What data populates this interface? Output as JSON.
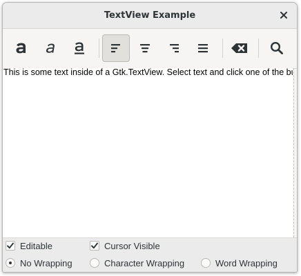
{
  "window": {
    "title": "TextView Example"
  },
  "toolbar": {
    "buttons": [
      {
        "name": "bold-button",
        "icon": "format-text-bold-icon"
      },
      {
        "name": "italic-button",
        "icon": "format-text-italic-icon"
      },
      {
        "name": "underline-button",
        "icon": "format-text-underline-icon"
      },
      {
        "name": "justify-left-button",
        "icon": "format-justify-left-icon",
        "active": true
      },
      {
        "name": "justify-center-button",
        "icon": "format-justify-center-icon"
      },
      {
        "name": "justify-right-button",
        "icon": "format-justify-right-icon"
      },
      {
        "name": "justify-fill-button",
        "icon": "format-justify-fill-icon"
      },
      {
        "name": "clear-formatting-button",
        "icon": "edit-clear-icon"
      },
      {
        "name": "search-button",
        "icon": "search-icon"
      }
    ]
  },
  "textview": {
    "text": "This is some text inside of a Gtk.TextView. Select text and click one of the buttons 'bold', 'italic', or 'underline' to modify the text accordingly."
  },
  "options": {
    "editable_label": "Editable",
    "editable_checked": true,
    "cursor_visible_label": "Cursor Visible",
    "cursor_visible_checked": true,
    "no_wrapping_label": "No Wrapping",
    "character_wrapping_label": "Character Wrapping",
    "word_wrapping_label": "Word Wrapping",
    "selected_wrapping": "No Wrapping"
  },
  "colors": {
    "text": "#2e3436",
    "window_bg": "#f6f5f4",
    "titlebar_bg": "#ebebeb"
  }
}
